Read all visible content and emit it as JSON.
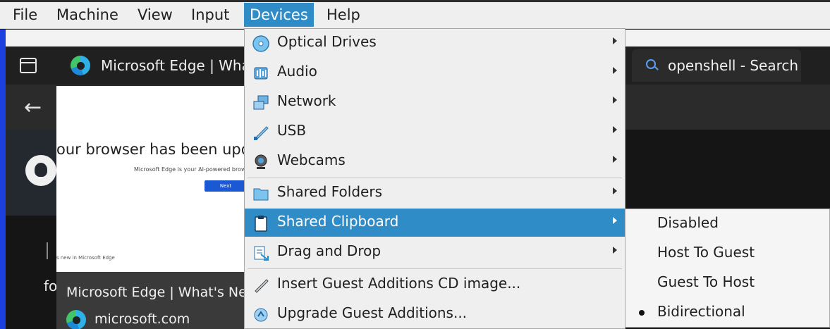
{
  "menubar": {
    "items": [
      {
        "label": "File"
      },
      {
        "label": "Machine"
      },
      {
        "label": "View"
      },
      {
        "label": "Input"
      },
      {
        "label": "Devices",
        "active": true
      },
      {
        "label": "Help"
      }
    ]
  },
  "browser": {
    "tabs": [
      {
        "title": "Microsoft Edge | What's New"
      },
      {
        "title": "openshell - Search"
      }
    ],
    "preview": {
      "headline": "our browser has been updated",
      "subtext": "Microsoft Edge is your AI-powered browser",
      "button_label": "Next",
      "small_text": "s new in Microsoft Edge",
      "card_title": "Microsoft Edge | What's New",
      "card_domain": "microsoft.com"
    },
    "page_text_fragment": "fo"
  },
  "devices_menu": {
    "items": [
      {
        "label": "Optical Drives",
        "icon": "optical-drive-icon",
        "submenu": true
      },
      {
        "label": "Audio",
        "icon": "audio-icon",
        "submenu": true
      },
      {
        "label": "Network",
        "icon": "network-icon",
        "submenu": true
      },
      {
        "label": "USB",
        "icon": "usb-icon",
        "submenu": true
      },
      {
        "label": "Webcams",
        "icon": "webcam-icon",
        "submenu": true
      },
      {
        "label": "Shared Folders",
        "icon": "shared-folder-icon",
        "submenu": true
      },
      {
        "label": "Shared Clipboard",
        "icon": "clipboard-icon",
        "submenu": true,
        "highlighted": true
      },
      {
        "label": "Drag and Drop",
        "icon": "drag-drop-icon",
        "submenu": true
      },
      {
        "label": "Insert Guest Additions CD image...",
        "icon": "guest-additions-cd-icon",
        "submenu": false
      },
      {
        "label": "Upgrade Guest Additions...",
        "icon": "upgrade-guest-additions-icon",
        "submenu": false
      }
    ]
  },
  "clipboard_submenu": {
    "items": [
      {
        "label": "Disabled",
        "selected": false
      },
      {
        "label": "Host To Guest",
        "selected": false
      },
      {
        "label": "Guest To Host",
        "selected": false
      },
      {
        "label": "Bidirectional",
        "selected": true
      }
    ]
  },
  "colors": {
    "highlight": "#308cc6",
    "menu_bg": "#efefef",
    "guest_border": "#1c3fe0"
  }
}
